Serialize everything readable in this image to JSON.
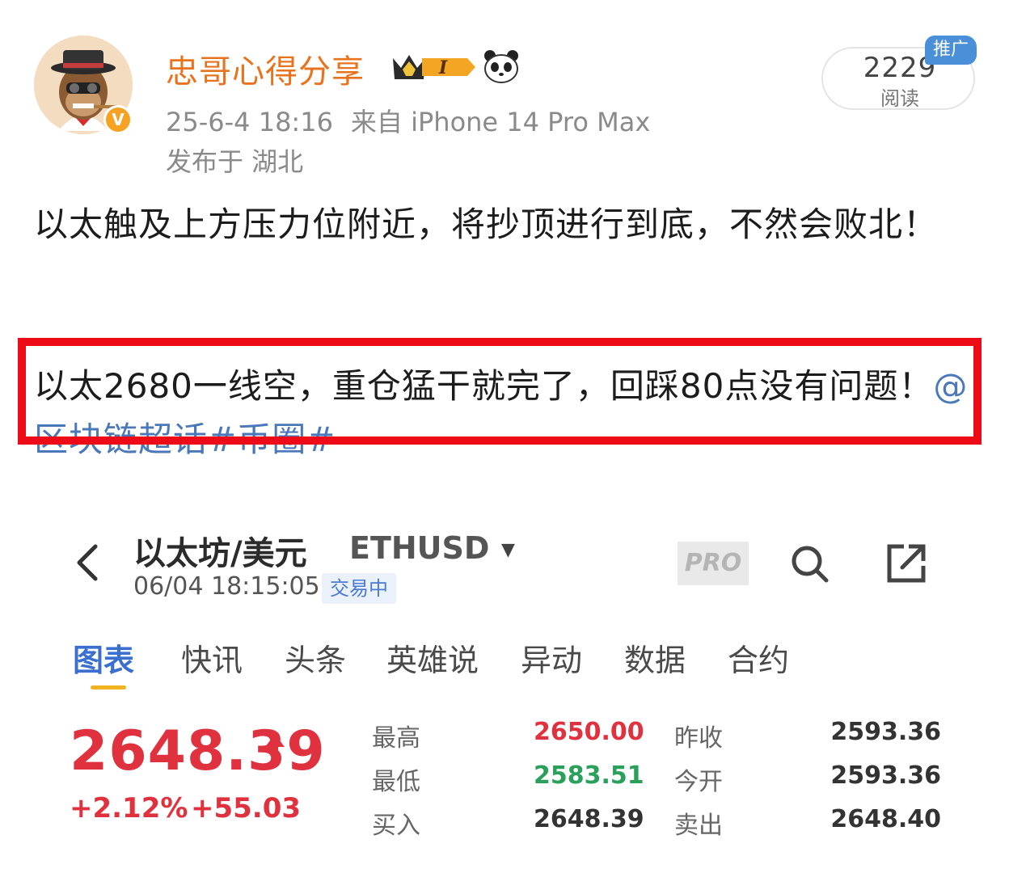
{
  "post": {
    "author": "忠哥心得分享",
    "meta_time": "25-6-4 18:16",
    "meta_source": "来自 iPhone 14 Pro Max",
    "location": "发布于 湖北",
    "read_count": "2229",
    "read_label": "阅读",
    "promo_tag": "推广",
    "crown_badge_text": "I",
    "paragraph1": "以太触及上方压力位附近，将抄顶进行到底，不然会败北！",
    "paragraph2_text": "以太2680一线空，重仓猛干就完了，回踩80点没有问题！",
    "paragraph2_topic": "@区块链超话#币圈#"
  },
  "quote": {
    "pair_title": "以太坊/美元",
    "pair_code": "ETHUSD",
    "time": "06/04 18:15:05",
    "status": "交易中",
    "pro_label": "PRO",
    "tabs": [
      "图表",
      "快讯",
      "头条",
      "英雄说",
      "异动",
      "数据",
      "合约"
    ],
    "active_tab": 0,
    "price": "2648.39",
    "change_pct": "+2.12%",
    "change_abs": "+55.03",
    "stats": [
      {
        "label": "最高",
        "value": "2650.00",
        "label2": "昨收",
        "value2": "2593.36"
      },
      {
        "label": "最低",
        "value": "2583.51",
        "label2": "今开",
        "value2": "2593.36"
      },
      {
        "label": "买入",
        "value": "2648.39",
        "label2": "卖出",
        "value2": "2648.40"
      }
    ]
  },
  "icons": [
    "verified-icon",
    "crown-badge-icon",
    "panda-icon",
    "back-arrow-icon",
    "dropdown-caret-icon",
    "search-icon",
    "share-icon",
    "price-up-arrow-icon"
  ],
  "colors": {
    "author": "#e8731f",
    "highlight_box": "#ec0b17",
    "topic_link": "#4a78b8",
    "active_tab": "#3a6fd0",
    "tab_underline": "#f2b321",
    "price_up": "#e0323e",
    "price_low": "#2aa05a",
    "promo": "#4a8fd8"
  }
}
